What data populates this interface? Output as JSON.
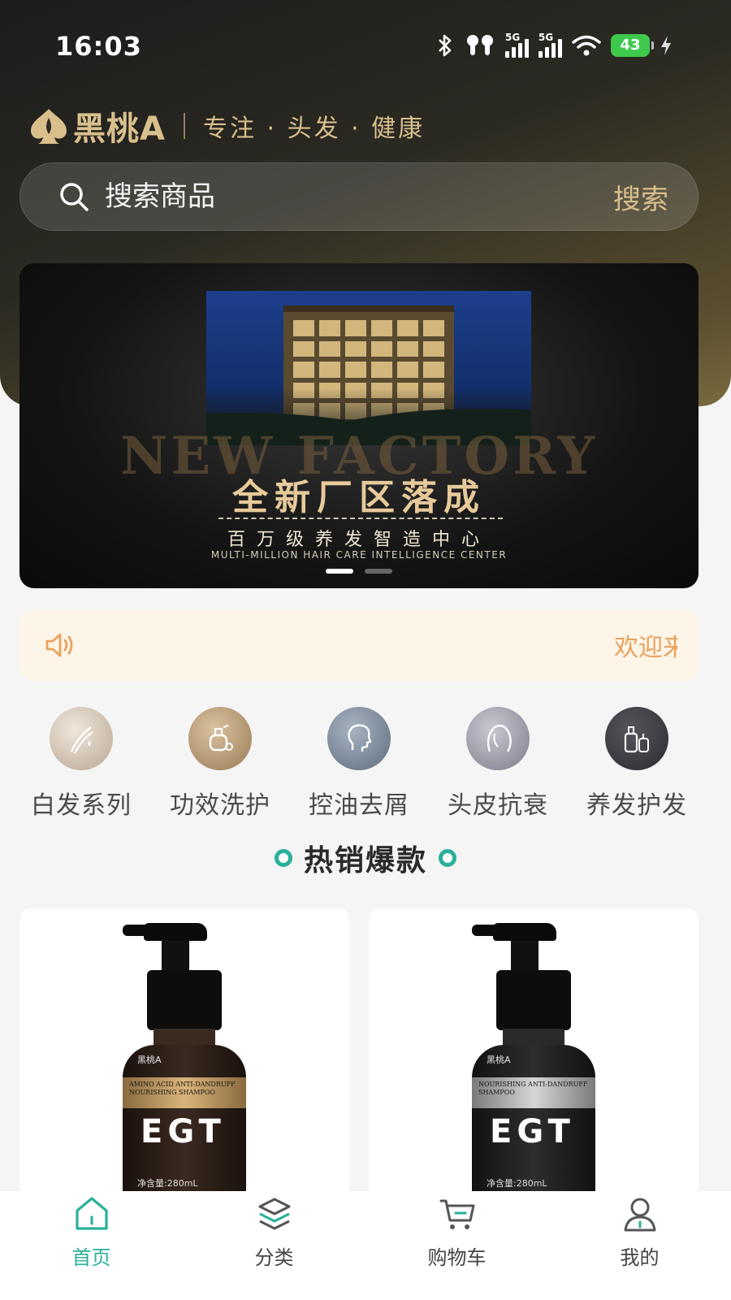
{
  "status_bar": {
    "time": "16:03",
    "signal_1_label": "5G",
    "signal_2_label": "5G",
    "battery_level": "43",
    "icons": [
      "bluetooth-icon",
      "earbuds-icon",
      "signal-icon",
      "signal-icon",
      "wifi-icon",
      "battery-icon",
      "charging-icon"
    ]
  },
  "header": {
    "brand_name": "黑桃A",
    "slogan": "专注 · 头发 · 健康"
  },
  "search": {
    "placeholder": "搜索商品",
    "button_label": "搜索"
  },
  "banner": {
    "english_watermark": "NEW FACTORY",
    "title": "全新厂区落成",
    "subtitle": "百万级养发智造中心",
    "caption": "MULTI-MILLION HAIR CARE INTELLIGENCE CENTER",
    "slide_count": 2,
    "active_slide": 1
  },
  "notice": {
    "text": "欢迎来"
  },
  "categories": [
    {
      "label": "白发系列",
      "icon": "hair-strand-icon",
      "color": "#c8b9a5"
    },
    {
      "label": "功效洗护",
      "icon": "perfume-bottle-icon",
      "color": "#b09676"
    },
    {
      "label": "控油去屑",
      "icon": "head-profile-icon",
      "color": "#7d8a99"
    },
    {
      "label": "头皮抗衰",
      "icon": "woman-hair-icon",
      "color": "#9a9aa6"
    },
    {
      "label": "养发护发",
      "icon": "bottles-leaf-icon",
      "color": "#3c3d42"
    }
  ],
  "hot_section": {
    "title": "热销爆款"
  },
  "products": [
    {
      "brand": "黑桃A",
      "band_text": "AMINO ACID ANTI-DANDRUFF NOURISHING SHAMPOO",
      "logo": "EGT",
      "net_content": "净含量:280mL"
    },
    {
      "brand": "黑桃A",
      "band_text": "NOURISHING ANTI-DANDRUFF SHAMPOO",
      "logo": "EGT",
      "net_content": "净含量:280mL"
    }
  ],
  "tab_bar": [
    {
      "label": "首页",
      "icon": "home-icon",
      "active": true
    },
    {
      "label": "分类",
      "icon": "layers-icon",
      "active": false
    },
    {
      "label": "购物车",
      "icon": "cart-icon",
      "active": false
    },
    {
      "label": "我的",
      "icon": "user-icon",
      "active": false
    }
  ],
  "colors": {
    "accent": "#2ab09a",
    "gold": "#d9bf8c",
    "notice_bg": "#fdf5e8",
    "notice_text": "#e9a25d"
  }
}
